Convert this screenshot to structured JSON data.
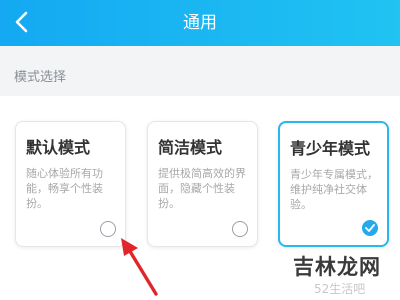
{
  "header": {
    "title": "通用",
    "back_icon": "chevron-left-icon"
  },
  "section": {
    "label": "模式选择"
  },
  "modes": [
    {
      "title": "默认模式",
      "description": "随心体验所有功能，畅享个性装扮。",
      "selected": false
    },
    {
      "title": "简洁模式",
      "description": "提供极简高效的界面，隐藏个性装扮。",
      "selected": false
    },
    {
      "title": "青少年模式",
      "description": "青少年专属模式，维护纯净社交体验。",
      "selected": true
    }
  ],
  "colors": {
    "header_start": "#14a9f2",
    "header_end": "#20c3f2",
    "selected_border": "#28b7ee",
    "check": "#23a9ec",
    "arrow": "#e1262b"
  },
  "watermark": {
    "logo": "吉林龙网",
    "site": "52生活吧"
  }
}
